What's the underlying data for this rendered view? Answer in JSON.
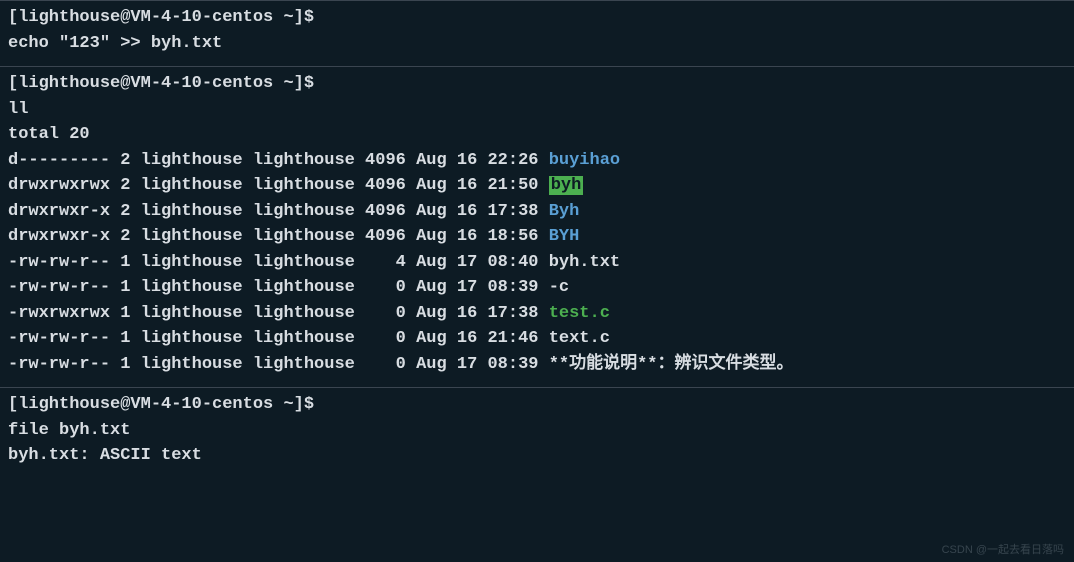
{
  "section1": {
    "prompt": "[lighthouse@VM-4-10-centos ~]$",
    "command": "echo \"123\" >> byh.txt"
  },
  "section2": {
    "prompt": "[lighthouse@VM-4-10-centos ~]$",
    "command": "ll",
    "total": "total 20",
    "rows": [
      {
        "perm": "d---------",
        "links": "2",
        "owner": "lighthouse",
        "group": "lighthouse",
        "size": "4096",
        "month": "Aug",
        "day": "16",
        "time": "22:26",
        "name": "buyihao",
        "style": "dir-blue"
      },
      {
        "perm": "drwxrwxrwx",
        "links": "2",
        "owner": "lighthouse",
        "group": "lighthouse",
        "size": "4096",
        "month": "Aug",
        "day": "16",
        "time": "21:50",
        "name": "byh",
        "style": "highlight-green"
      },
      {
        "perm": "drwxrwxr-x",
        "links": "2",
        "owner": "lighthouse",
        "group": "lighthouse",
        "size": "4096",
        "month": "Aug",
        "day": "16",
        "time": "17:38",
        "name": "Byh",
        "style": "dir-blue"
      },
      {
        "perm": "drwxrwxr-x",
        "links": "2",
        "owner": "lighthouse",
        "group": "lighthouse",
        "size": "4096",
        "month": "Aug",
        "day": "16",
        "time": "18:56",
        "name": "BYH",
        "style": "dir-blue"
      },
      {
        "perm": "-rw-rw-r--",
        "links": "1",
        "owner": "lighthouse",
        "group": "lighthouse",
        "size": "   4",
        "month": "Aug",
        "day": "17",
        "time": "08:40",
        "name": "byh.txt",
        "style": "file-white"
      },
      {
        "perm": "-rw-rw-r--",
        "links": "1",
        "owner": "lighthouse",
        "group": "lighthouse",
        "size": "   0",
        "month": "Aug",
        "day": "17",
        "time": "08:39",
        "name": "-c",
        "style": "file-white"
      },
      {
        "perm": "-rwxrwxrwx",
        "links": "1",
        "owner": "lighthouse",
        "group": "lighthouse",
        "size": "   0",
        "month": "Aug",
        "day": "16",
        "time": "17:38",
        "name": "test.c",
        "style": "file-green"
      },
      {
        "perm": "-rw-rw-r--",
        "links": "1",
        "owner": "lighthouse",
        "group": "lighthouse",
        "size": "   0",
        "month": "Aug",
        "day": "16",
        "time": "21:46",
        "name": "text.c",
        "style": "file-white"
      },
      {
        "perm": "-rw-rw-r--",
        "links": "1",
        "owner": "lighthouse",
        "group": "lighthouse",
        "size": "   0",
        "month": "Aug",
        "day": "17",
        "time": "08:39",
        "name": "**功能说明**：辨识文件类型。",
        "style": "file-white"
      }
    ]
  },
  "section3": {
    "prompt": "[lighthouse@VM-4-10-centos ~]$",
    "command": "file byh.txt",
    "output": "byh.txt: ASCII text"
  },
  "watermark": "CSDN @一起去看日落吗"
}
